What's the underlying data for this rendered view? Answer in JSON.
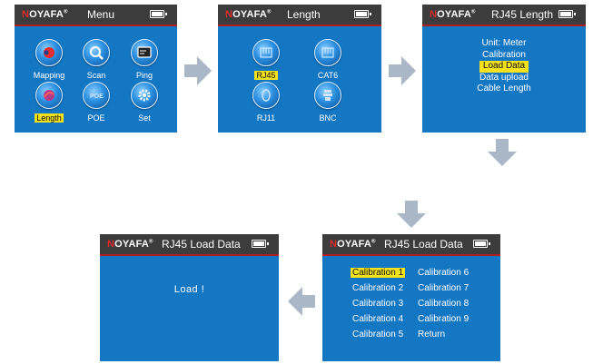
{
  "brand": {
    "prefix": "N",
    "rest": "OYAFA",
    "mark": "®"
  },
  "screen1": {
    "title": "Menu",
    "items": [
      {
        "label": "Mapping",
        "icon": "mapping-icon"
      },
      {
        "label": "Scan",
        "icon": "scan-icon"
      },
      {
        "label": "Ping",
        "icon": "ping-icon"
      },
      {
        "label": "Length",
        "icon": "length-icon",
        "selected": true
      },
      {
        "label": "POE",
        "icon": "poe-icon"
      },
      {
        "label": "Set",
        "icon": "set-icon"
      }
    ]
  },
  "screen2": {
    "title": "Length",
    "items": [
      {
        "label": "RJ45",
        "icon": "rj45-icon",
        "selected": true
      },
      {
        "label": "CAT6",
        "icon": "cat6-icon"
      },
      {
        "label": "RJ11",
        "icon": "rj11-icon"
      },
      {
        "label": "BNC",
        "icon": "bnc-icon"
      }
    ]
  },
  "screen3": {
    "title": "RJ45 Length",
    "items": [
      "Unit: Meter",
      "Calibration",
      "Load Data",
      "Data upload",
      "Cable Length"
    ],
    "selected_index": 2
  },
  "screen4": {
    "title": "RJ45 Load Data",
    "col1": [
      "Calibration 1",
      "Calibration 2",
      "Calibration 3",
      "Calibration 4",
      "Calibration 5"
    ],
    "col2": [
      "Calibration 6",
      "Calibration 7",
      "Calibration 8",
      "Calibration 9",
      "Return"
    ],
    "selected": "Calibration 1"
  },
  "screen5": {
    "title": "RJ45 Load Data",
    "message": "Load !"
  },
  "colors": {
    "screen_bg": "#1477c4",
    "titlebar_bg": "#3c3c3c",
    "titlebar_border": "#b01d1d",
    "highlight": "#f3e21a",
    "arrow": "#a9b7c6"
  }
}
